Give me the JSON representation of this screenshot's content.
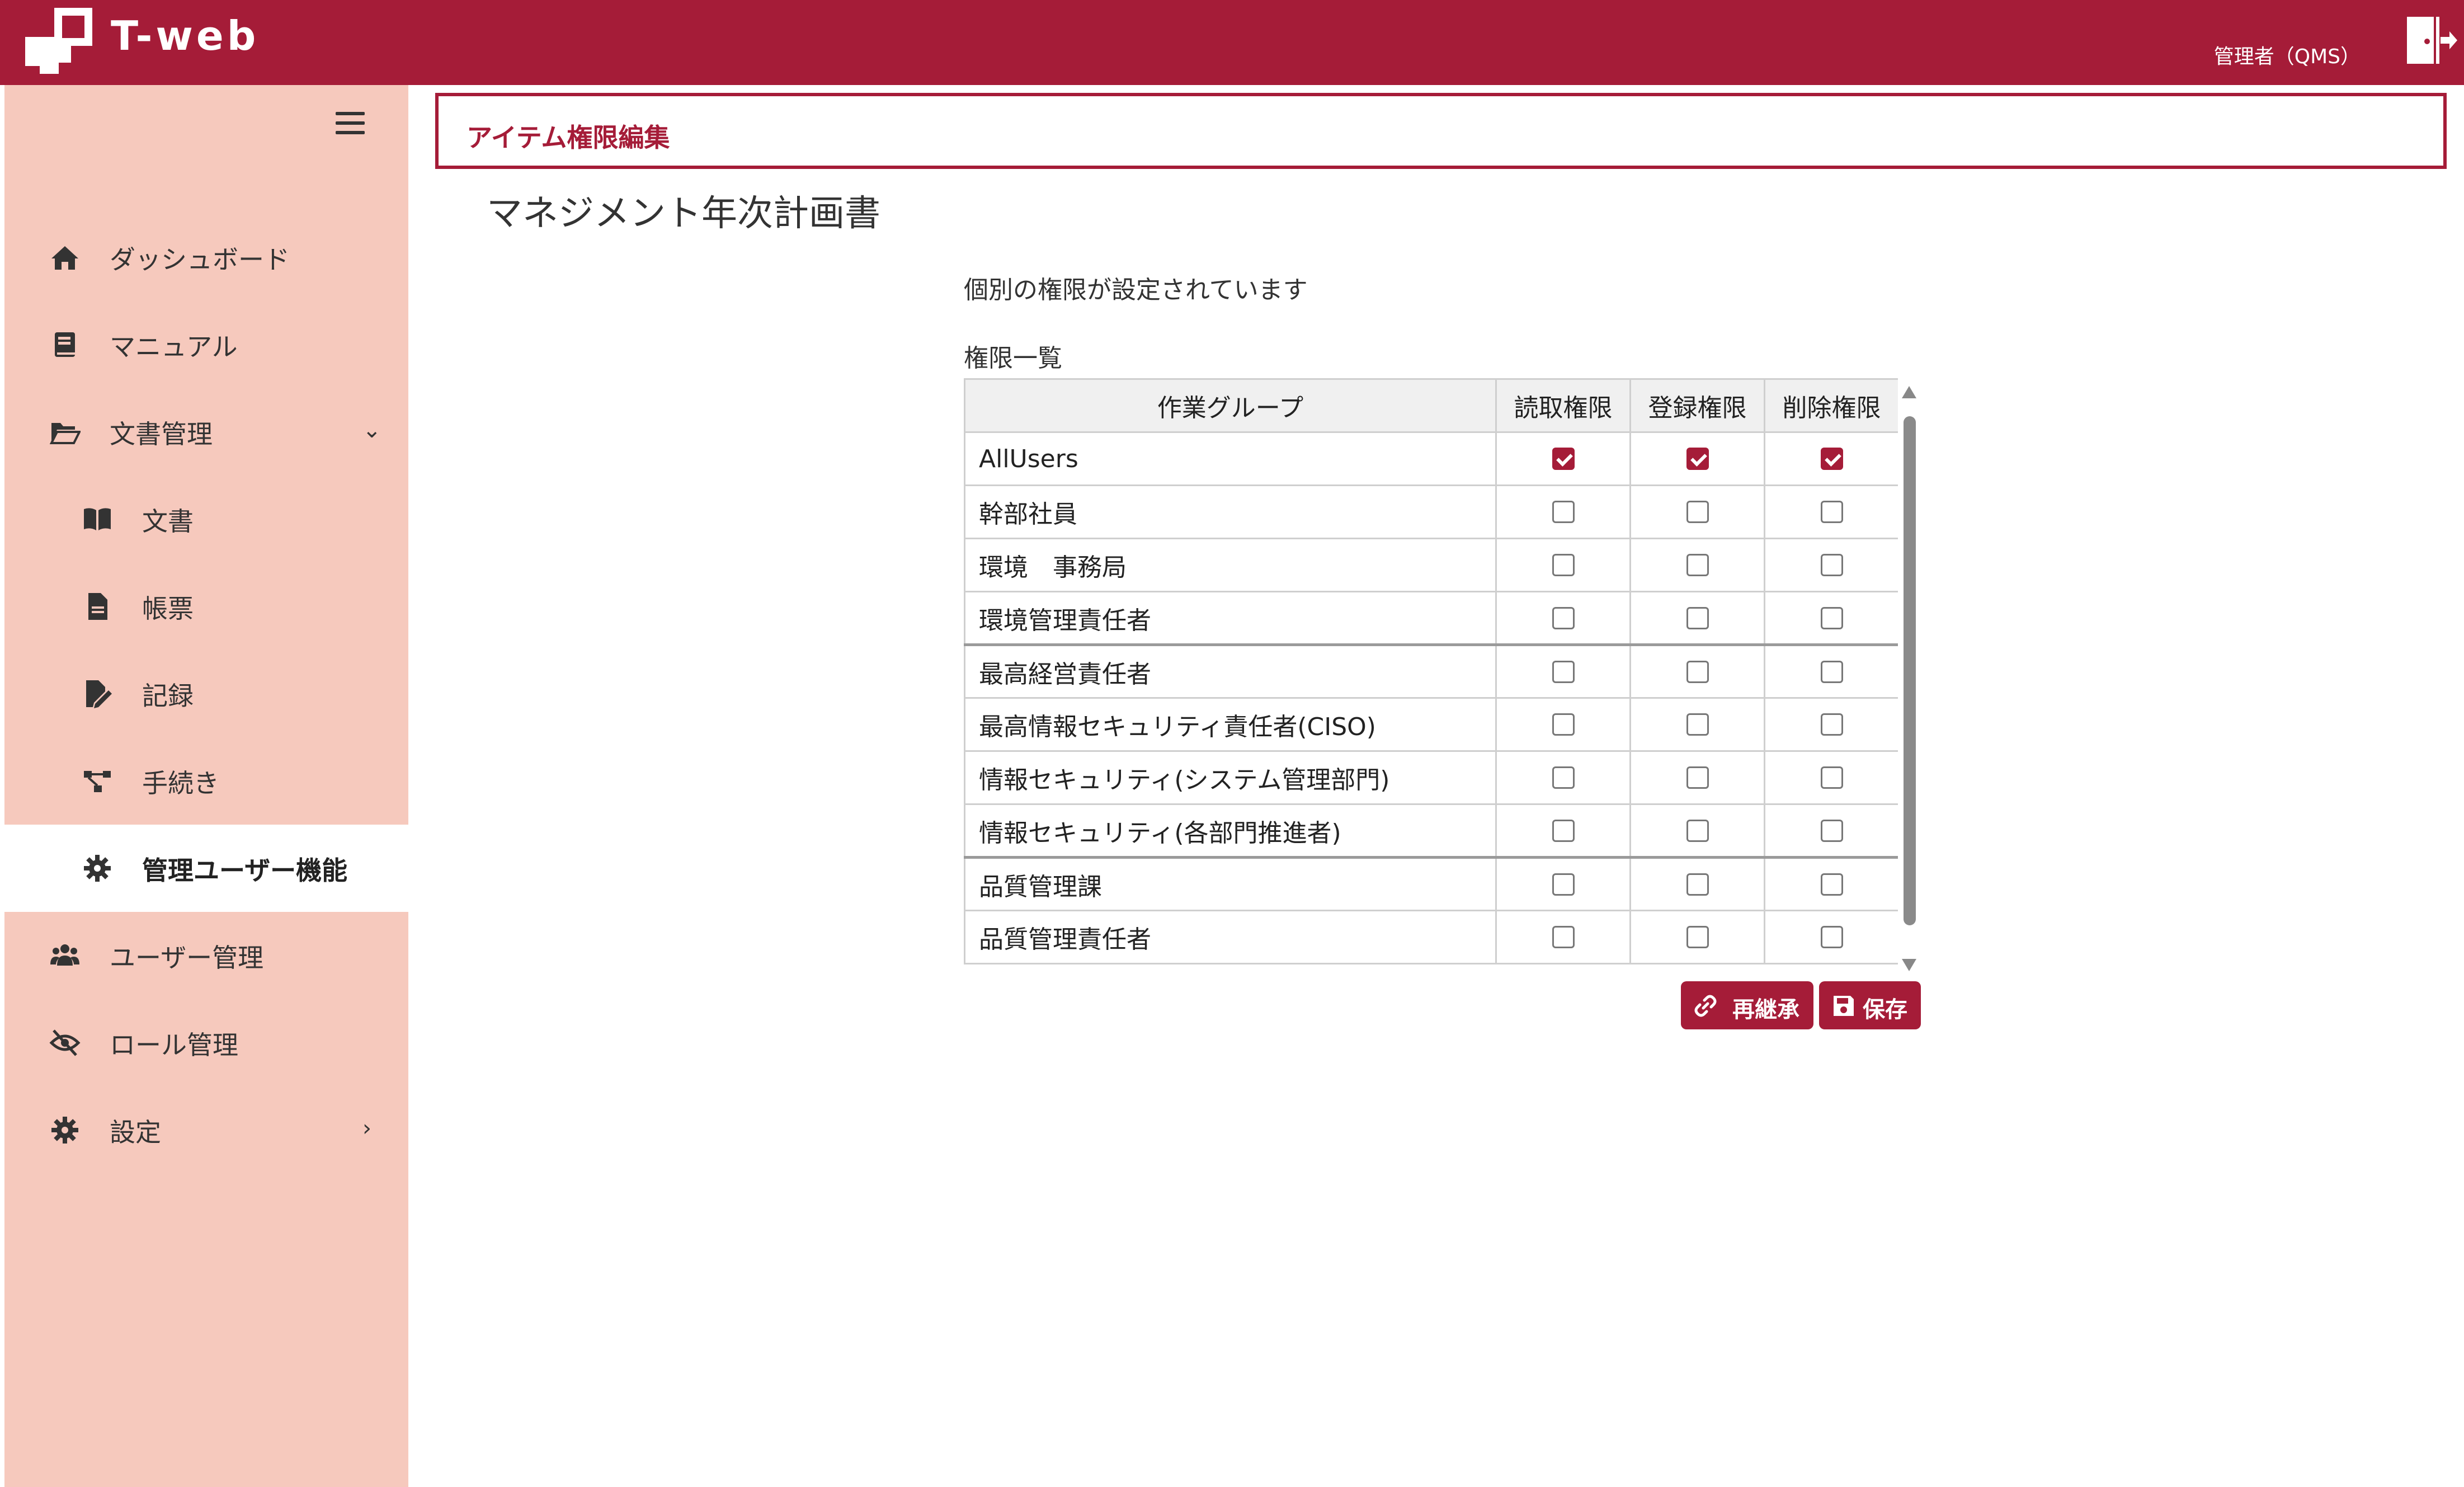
{
  "header": {
    "brand": "T-web",
    "user": "管理者（QMS）",
    "colors": {
      "primary": "#a51c38",
      "sidebar": "#f6c9bd"
    }
  },
  "sidebar": {
    "items": [
      {
        "label": "ダッシュボード",
        "icon": "home-icon"
      },
      {
        "label": "マニュアル",
        "icon": "manual-book-icon"
      },
      {
        "label": "文書管理",
        "icon": "folder-open-icon",
        "chevron": "⌄"
      },
      {
        "label": "文書",
        "icon": "open-book-icon"
      },
      {
        "label": "帳票",
        "icon": "file-icon"
      },
      {
        "label": "記録",
        "icon": "edit-file-icon"
      },
      {
        "label": "手続き",
        "icon": "flow-icon"
      },
      {
        "label": "管理ユーザー機能",
        "icon": "gear-icon"
      },
      {
        "label": "ユーザー管理",
        "icon": "users-icon"
      },
      {
        "label": "ロール管理",
        "icon": "eye-slash-icon"
      },
      {
        "label": "設定",
        "icon": "gear-icon",
        "chevron": "›"
      }
    ]
  },
  "main": {
    "section_title": "アイテム権限編集",
    "document_title": "マネジメント年次計画書",
    "notice": "個別の権限が設定されています",
    "list_caption": "権限一覧",
    "table": {
      "headers": [
        "作業グループ",
        "読取権限",
        "登録権限",
        "削除権限"
      ],
      "rows": [
        {
          "name": "AllUsers",
          "read": true,
          "write": true,
          "delete": true
        },
        {
          "name": "幹部社員",
          "read": false,
          "write": false,
          "delete": false
        },
        {
          "name": "環境　事務局",
          "read": false,
          "write": false,
          "delete": false
        },
        {
          "name": "環境管理責任者",
          "read": false,
          "write": false,
          "delete": false
        },
        {
          "name": "最高経営責任者",
          "read": false,
          "write": false,
          "delete": false
        },
        {
          "name": "最高情報セキュリティ責任者(CISO)",
          "read": false,
          "write": false,
          "delete": false
        },
        {
          "name": "情報セキュリティ(システム管理部門)",
          "read": false,
          "write": false,
          "delete": false
        },
        {
          "name": "情報セキュリティ(各部門推進者)",
          "read": false,
          "write": false,
          "delete": false
        },
        {
          "name": "品質管理課",
          "read": false,
          "write": false,
          "delete": false
        },
        {
          "name": "品質管理責任者",
          "read": false,
          "write": false,
          "delete": false
        }
      ]
    },
    "buttons": {
      "reinherit": "再継承",
      "save": "保存"
    }
  }
}
